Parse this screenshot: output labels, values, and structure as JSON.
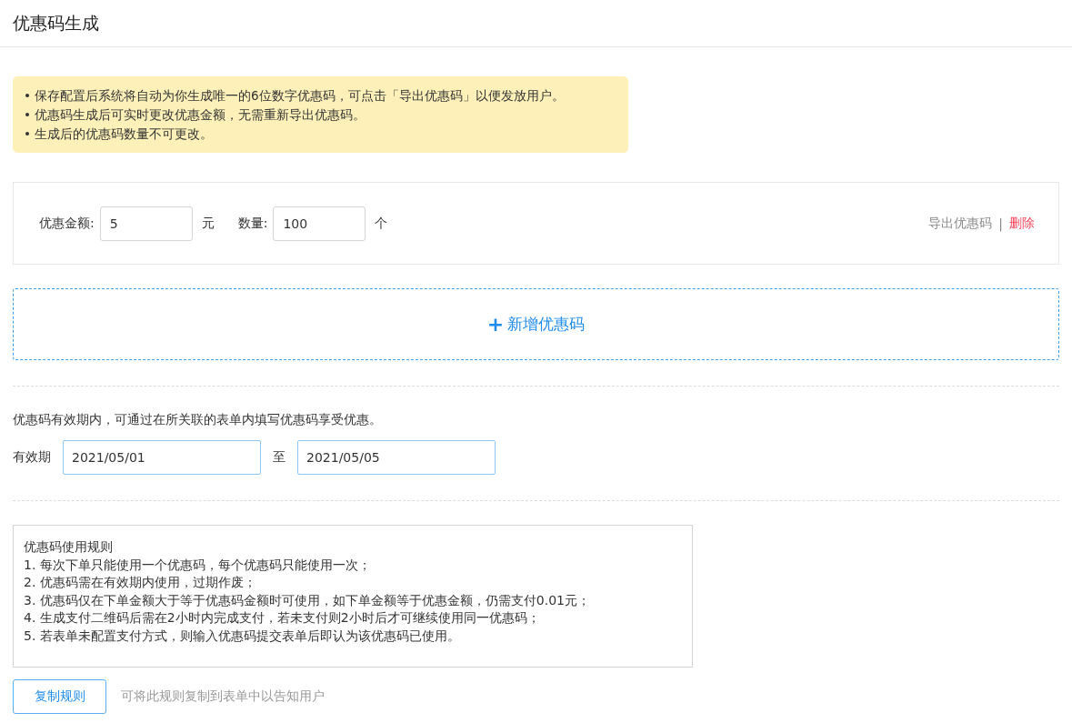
{
  "page_title": "优惠码生成",
  "notice": [
    "保存配置后系统将自动为你生成唯一的6位数字优惠码，可点击「导出优惠码」以便发放用户。",
    "优惠码生成后可实时更改优惠金额，无需重新导出优惠码。",
    "生成后的优惠码数量不可更改。"
  ],
  "coupons": [
    {
      "amount_label": "优惠金额:",
      "amount": "5",
      "amount_unit": "元",
      "count_label": "数量:",
      "count": "100",
      "count_unit": "个",
      "export_link": "导出优惠码",
      "separator": "|",
      "delete_link": "删除"
    }
  ],
  "add_button": {
    "icon": "+",
    "label": "新增优惠码"
  },
  "validity": {
    "description": "优惠码有效期内，可通过在所关联的表单内填写优惠码享受优惠。",
    "label": "有效期",
    "start": "2021/05/01",
    "to": "至",
    "end": "2021/05/05"
  },
  "rules": {
    "title": "优惠码使用规则",
    "lines": [
      "1. 每次下单只能使用一个优惠码，每个优惠码只能使用一次；",
      "2. 优惠码需在有效期内使用，过期作废；",
      "3. 优惠码仅在下单金额大于等于优惠码金额时可使用，如下单金额等于优惠金额，仍需支付0.01元；",
      "4. 生成支付二维码后需在2小时内完成支付，若未支付则2小时后才可继续使用同一优惠码；",
      "5. 若表单未配置支付方式，则输入优惠码提交表单后即认为该优惠码已使用。"
    ]
  },
  "copy_button": "复制规则",
  "copy_hint": "可将此规则复制到表单中以告知用户"
}
